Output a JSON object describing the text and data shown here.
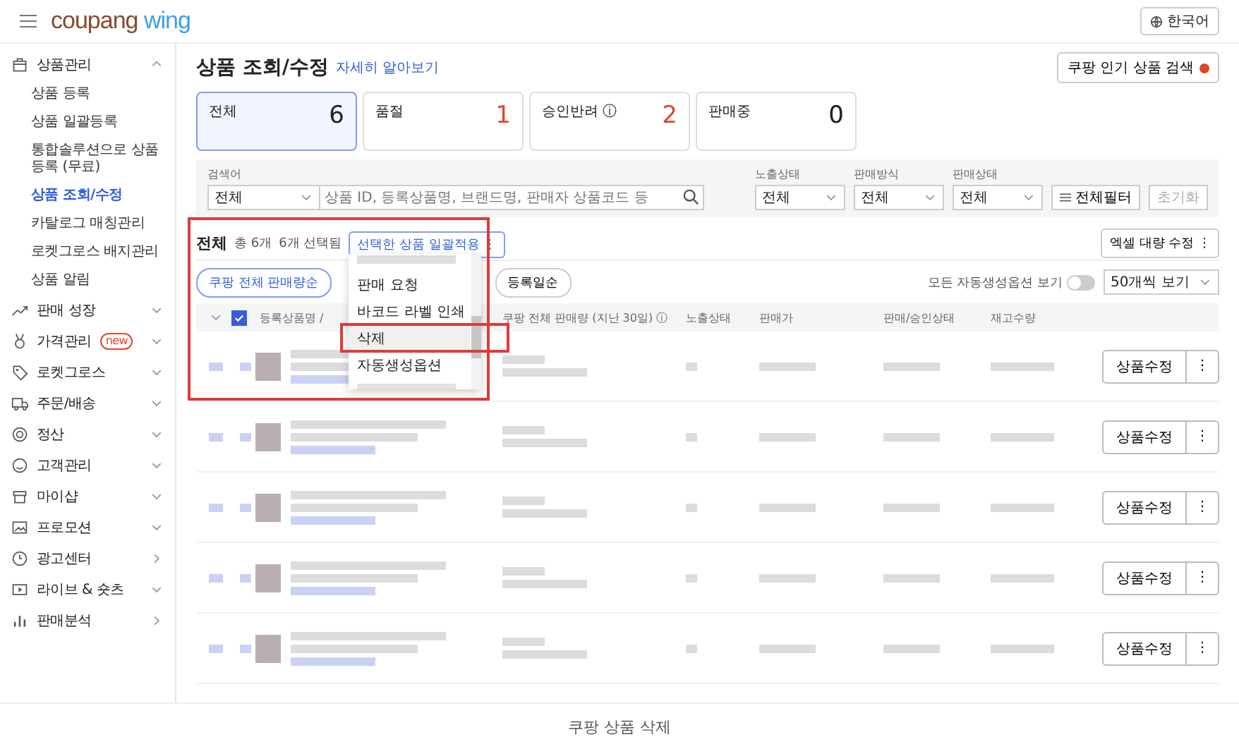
{
  "header": {
    "logo": {
      "brand": "coupang",
      "product": "wing"
    },
    "language": "한국어"
  },
  "sidebar": {
    "items": [
      {
        "label": "상품관리",
        "kind": "group",
        "expanded": true,
        "children": [
          {
            "label": "상품 등록",
            "selected": false
          },
          {
            "label": "상품 일괄등록",
            "selected": false
          },
          {
            "label": "통합솔루션으로 상품등록 (무료)",
            "selected": false
          },
          {
            "label": "상품 조회/수정",
            "selected": true
          },
          {
            "label": "카탈로그 매칭관리",
            "selected": false
          },
          {
            "label": "로켓그로스 배지관리",
            "selected": false
          },
          {
            "label": "상품 알림",
            "selected": false
          }
        ]
      },
      {
        "label": "판매 성장",
        "kind": "group",
        "expanded": false
      },
      {
        "label": "가격관리",
        "kind": "group",
        "expanded": false,
        "badge": "new"
      },
      {
        "label": "로켓그로스",
        "kind": "group",
        "expanded": false
      },
      {
        "label": "주문/배송",
        "kind": "group",
        "expanded": false
      },
      {
        "label": "정산",
        "kind": "group",
        "expanded": false
      },
      {
        "label": "고객관리",
        "kind": "group",
        "expanded": false
      },
      {
        "label": "마이샵",
        "kind": "group",
        "expanded": false
      },
      {
        "label": "프로모션",
        "kind": "group",
        "expanded": false
      },
      {
        "label": "광고센터",
        "kind": "link"
      },
      {
        "label": "라이브 & 숏츠",
        "kind": "group",
        "expanded": false
      },
      {
        "label": "판매분석",
        "kind": "link"
      }
    ]
  },
  "page": {
    "title": "상품 조회/수정",
    "help_link": "자세히 알아보기",
    "popular_button": "쿠팡 인기 상품 검색"
  },
  "status_cards": [
    {
      "label": "전체",
      "count": "6",
      "selected": true,
      "color": "#222222"
    },
    {
      "label": "품절",
      "count": "1",
      "selected": false,
      "color": "#e0452b"
    },
    {
      "label": "승인반려",
      "info": "ⓘ",
      "count": "2",
      "selected": false,
      "color": "#e0452b"
    },
    {
      "label": "판매중",
      "count": "0",
      "selected": false,
      "color": "#222222"
    }
  ],
  "filters": {
    "search": {
      "label": "검색어",
      "scope": "전체",
      "placeholder": "상품 ID, 등록상품명, 브랜드명, 판매자 상품코드 등"
    },
    "selects": [
      {
        "label": "노출상태",
        "value": "전체"
      },
      {
        "label": "판매방식",
        "value": "전체"
      },
      {
        "label": "판매상태",
        "value": "전체"
      }
    ],
    "all_filter_button": "전체필터",
    "reset_button": "초기화"
  },
  "list": {
    "title": "전체",
    "total": "총 6개",
    "selected_count": "6개 선택됨",
    "bulk_button": "선택한 상품 일괄적용 ⋮",
    "excel_button": "엑셀 대량 수정 ⋮",
    "sort_pills": [
      {
        "label": "쿠팡 전체 판매량순",
        "selected": true
      },
      {
        "label": "등록일순",
        "selected": false
      }
    ],
    "auto_options_toggle": {
      "label": "모든 자동생성옵션 보기",
      "on": false
    },
    "page_size": "50개씩 보기"
  },
  "bulk_menu": {
    "items": [
      {
        "label": "판매 요청",
        "selected": false
      },
      {
        "label": "바코드 라벨 인쇄",
        "selected": false
      },
      {
        "label": "삭제",
        "selected": true
      },
      {
        "label": "자동생성옵션",
        "selected": false
      }
    ]
  },
  "table": {
    "all_checked": true,
    "columns": [
      "등록상품명 /",
      "쿠팡 전체 판매량 (지난 30일) ⓘ",
      "노출상태",
      "판매가",
      "판매/승인상태",
      "재고수량"
    ],
    "rows": [
      {
        "edit_button": "상품수정",
        "more_button": "⋮"
      },
      {
        "edit_button": "상품수정",
        "more_button": "⋮"
      },
      {
        "edit_button": "상품수정",
        "more_button": "⋮"
      },
      {
        "edit_button": "상품수정",
        "more_button": "⋮"
      },
      {
        "edit_button": "상품수정",
        "more_button": "⋮"
      }
    ]
  },
  "caption": "쿠팡 상품 삭제"
}
